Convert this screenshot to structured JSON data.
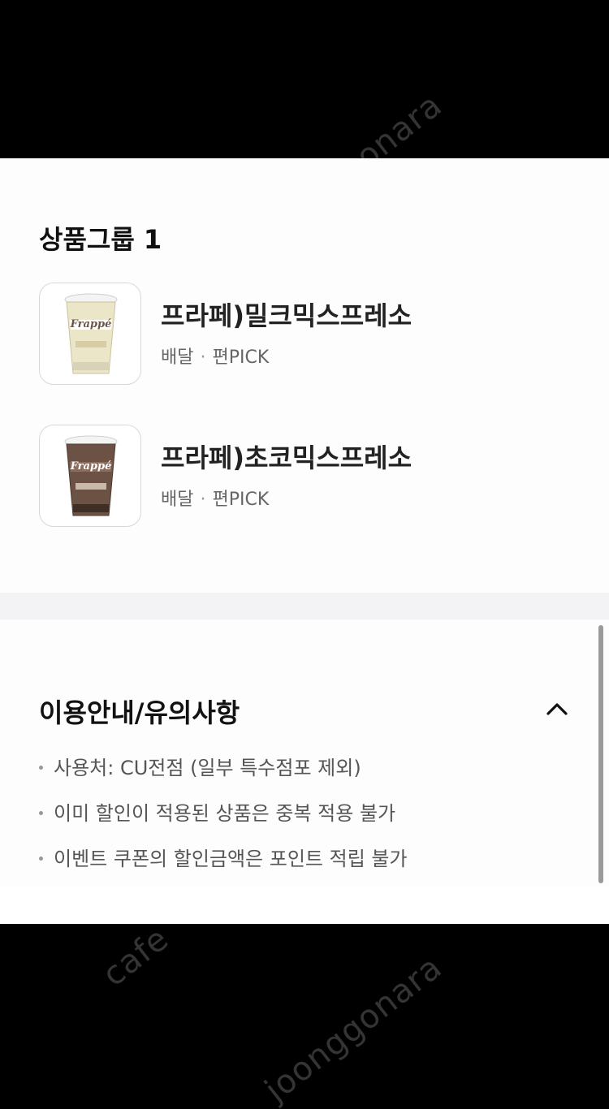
{
  "watermark": {
    "text_top": "joonggonara",
    "text_bottom_left": "cafe",
    "text_bottom": "joonggonara"
  },
  "group": {
    "title": "상품그룹 1"
  },
  "products": [
    {
      "name": "프라페)밀크믹스프레소",
      "meta_delivery": "배달",
      "meta_separator": "·",
      "meta_pick": "편PICK",
      "cup_label": "Frappé",
      "image_icon": "frappe-milk-cup-icon",
      "cup_color": "#ece6c8"
    },
    {
      "name": "프라페)초코믹스프레소",
      "meta_delivery": "배달",
      "meta_separator": "·",
      "meta_pick": "편PICK",
      "cup_label": "Frappé",
      "image_icon": "frappe-choco-cup-icon",
      "cup_color": "#6b5245"
    }
  ],
  "info": {
    "title": "이용안내/유의사항",
    "toggle_icon": "chevron-up-icon",
    "items": [
      "사용처: CU전점 (일부 특수점포 제외)",
      "이미 할인이 적용된 상품은 중복 적용 불가",
      "이벤트 쿠폰의 할인금액은 포인트 적립 불가"
    ]
  },
  "colors": {
    "background": "#000000",
    "card": "#ffffff",
    "divider": "#f3f3f5",
    "title_text": "#111111",
    "meta_text": "#666666"
  }
}
